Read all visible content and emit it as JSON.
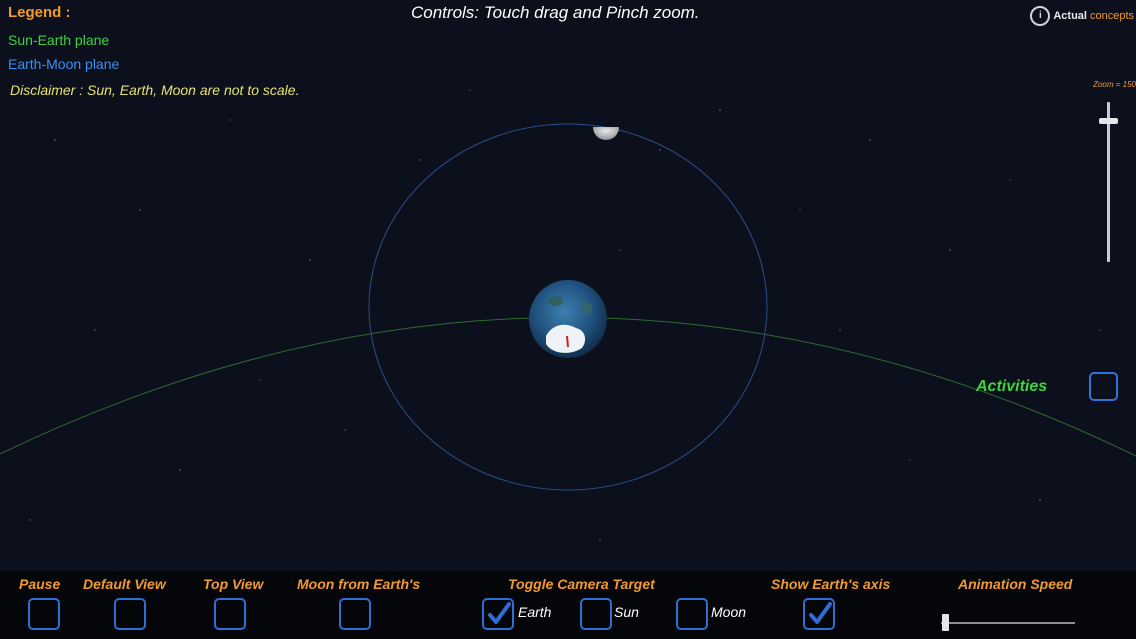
{
  "legend": {
    "title": "Legend :",
    "sun_earth_plane": "Sun-Earth plane",
    "earth_moon_plane": "Earth-Moon plane",
    "disclaimer": "Disclaimer : Sun, Earth, Moon are not  to  scale."
  },
  "controls_hint": "Controls: Touch drag and Pinch zoom.",
  "brand": {
    "name_a": "Actual",
    "name_b": "concepts",
    "icon": "actual-concepts-logo-icon"
  },
  "zoom": {
    "label": "Zoom = 150",
    "value": 150
  },
  "activities": {
    "label": "Activities",
    "checked": false
  },
  "bottom_bar": {
    "pause": {
      "label": "Pause",
      "checked": false
    },
    "default_view": {
      "label": "Default View",
      "checked": false
    },
    "top_view": {
      "label": "Top View",
      "checked": false
    },
    "moon_from_earth": {
      "label": "Moon from Earth's",
      "checked": false
    },
    "camera_target": {
      "label": "Toggle Camera Target",
      "options": [
        {
          "label": "Earth",
          "checked": true
        },
        {
          "label": "Sun",
          "checked": false
        },
        {
          "label": "Moon",
          "checked": false
        }
      ]
    },
    "show_axis": {
      "label": "Show Earth's axis",
      "checked": true
    },
    "animation_speed": {
      "label": "Animation Speed",
      "value": 0
    }
  },
  "colors": {
    "accent_orange": "#f29a2e",
    "sun_earth_green": "#3fd43f",
    "earth_moon_blue": "#3b8ff0",
    "disclaimer_yellow": "#e8e26a",
    "checkbox_blue": "#2d6fd6"
  }
}
